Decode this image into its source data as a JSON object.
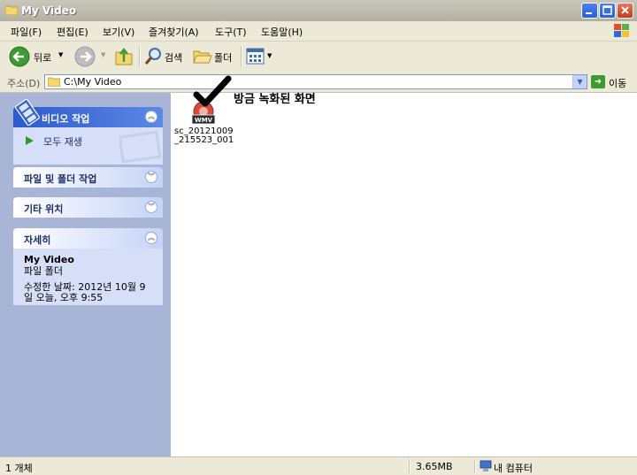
{
  "window": {
    "title": "My Video"
  },
  "menubar": {
    "items": [
      {
        "label": "파일(F)"
      },
      {
        "label": "편집(E)"
      },
      {
        "label": "보기(V)"
      },
      {
        "label": "즐겨찾기(A)"
      },
      {
        "label": "도구(T)"
      },
      {
        "label": "도움말(H)"
      }
    ]
  },
  "toolbar": {
    "back_label": "뒤로",
    "search_label": "검색",
    "folders_label": "폴더"
  },
  "address": {
    "label": "주소(D)",
    "value": "C:\\My Video",
    "go_label": "이동"
  },
  "taskpane": {
    "video_tasks": {
      "title": "비디오 작업",
      "play_all": "모두 재생"
    },
    "file_folder_tasks": {
      "title": "파일 및 폴더 작업"
    },
    "other_places": {
      "title": "기타 위치"
    },
    "details": {
      "title": "자세히",
      "name": "My Video",
      "type": "파일 폴더",
      "modified_line1": "수정한 날짜: 2012년 10월 9",
      "modified_line2": "일 오늘, 오후 9:55"
    }
  },
  "content": {
    "files": [
      {
        "name_line1": "sc_20121009",
        "name_line2": "_215523_001",
        "icon": "wmv-file-icon",
        "badge": "WMV"
      }
    ],
    "annotation": "방금 녹화된 화면"
  },
  "statusbar": {
    "object_count": "1 개체",
    "size": "3.65MB",
    "location": "내 컴퓨터"
  },
  "colors": {
    "titlebar": "#BDBAAD",
    "taskpane_bg": "#A9B5D6",
    "panel_body": "#D6DFF7",
    "accent_blue": "#2C5ACA",
    "close_red": "#C73B1B"
  }
}
